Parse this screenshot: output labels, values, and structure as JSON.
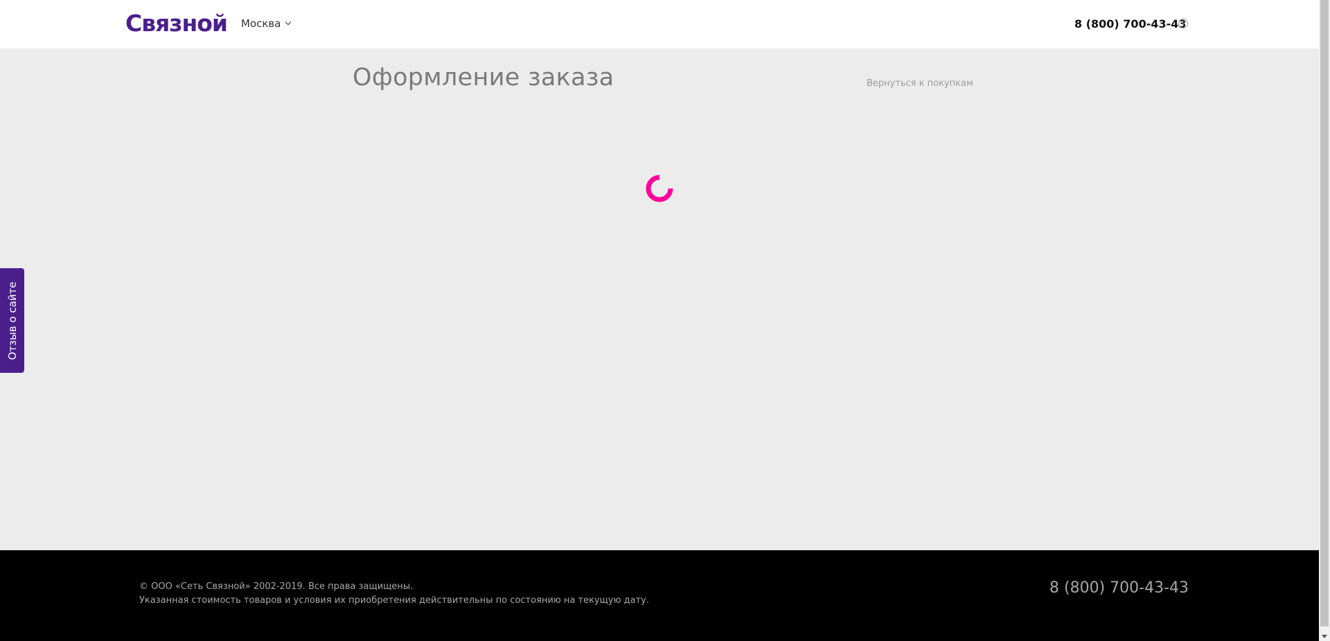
{
  "header": {
    "logo": "Связной",
    "city": "Москва",
    "phone": "8 (800) 700-43-43",
    "info_icon": "info-icon"
  },
  "main": {
    "title": "Оформление заказа",
    "back_link": "Вернуться к покупкам",
    "loading_icon": "spinner-icon",
    "spinner_color": "#ff0099"
  },
  "feedback": {
    "label": "Отзыв о сайте"
  },
  "footer": {
    "copyright": "© ООО «Сеть Связной» 2002-2019. Все права защищены.",
    "disclaimer": "Указанная стоимость товаров и условия их приобретения действительны по состоянию на текущую дату.",
    "phone": "8 (800) 700-43-43"
  },
  "colors": {
    "brand": "#4a1f8c",
    "accent": "#ff0099",
    "background": "#ececec",
    "footer": "#000000"
  }
}
